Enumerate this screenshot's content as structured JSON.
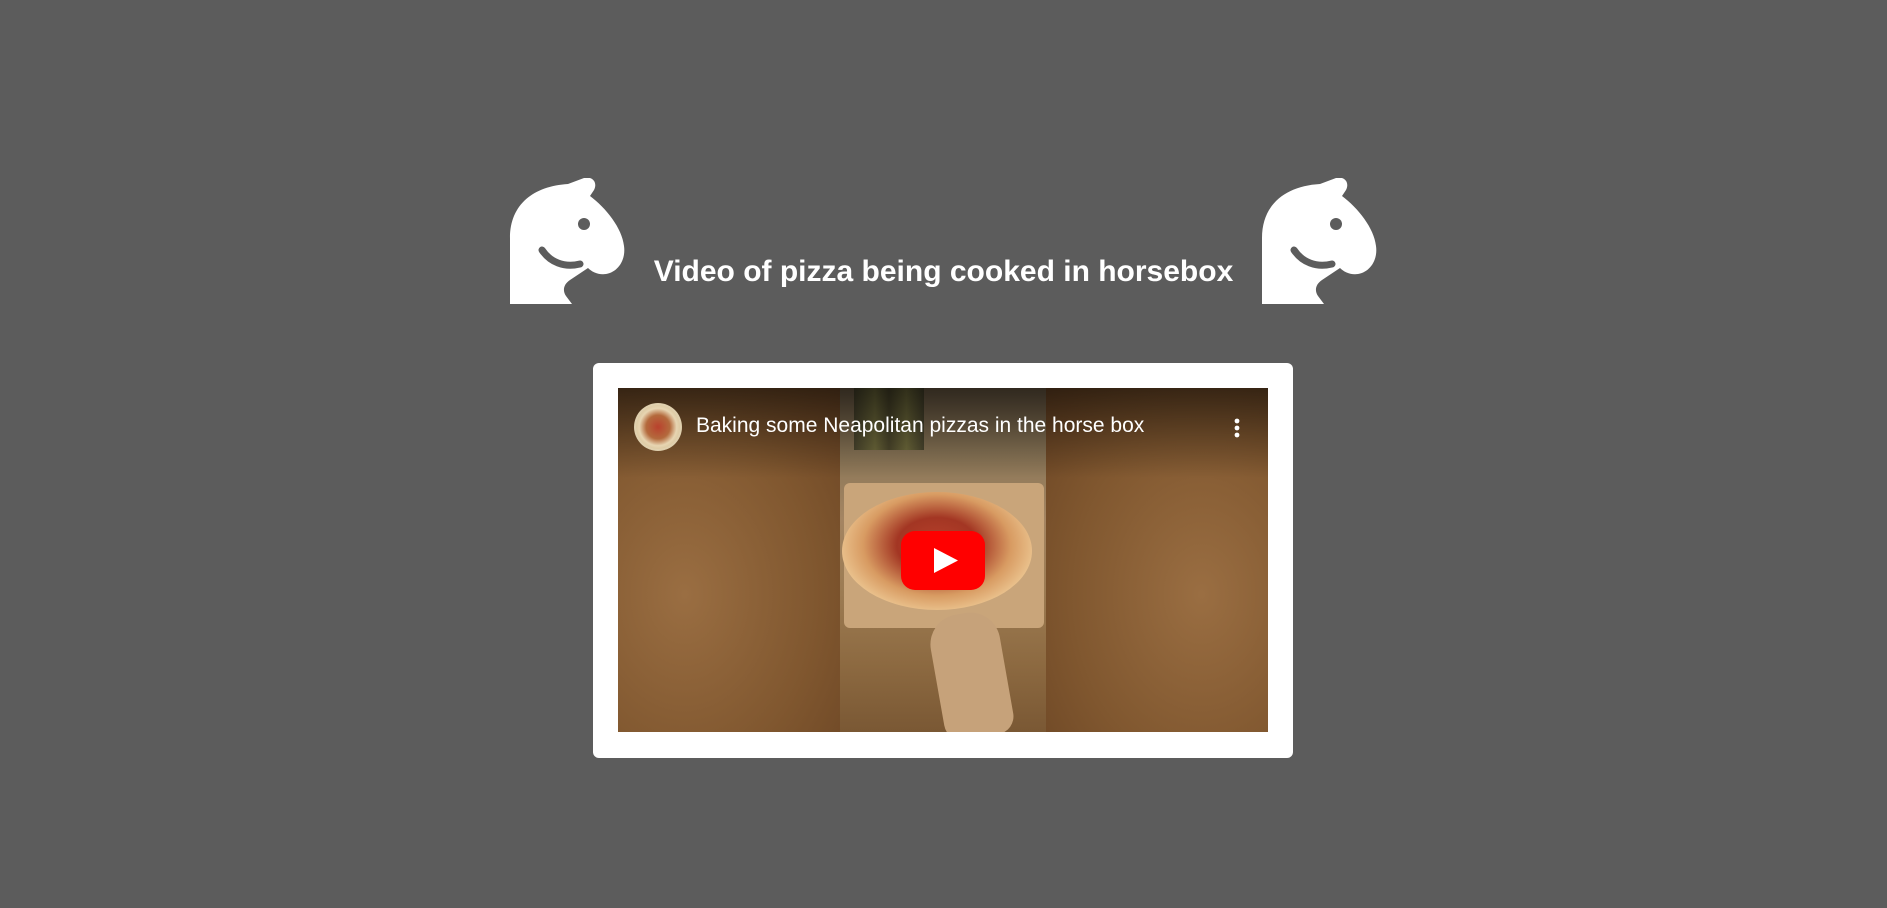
{
  "page": {
    "title": "Video of pizza being cooked in horsebox"
  },
  "header": {
    "left_icon": "horse-head-icon",
    "right_icon": "horse-head-icon"
  },
  "video": {
    "title": "Baking some Neapolitan pizzas in the horse box",
    "channel_avatar": "channel-avatar",
    "more_icon": "more-vertical-icon",
    "play_icon": "youtube-play-icon"
  },
  "colors": {
    "background": "#5c5c5c",
    "card": "#ffffff",
    "title_text": "#ffffff",
    "play_red": "#ff0000"
  }
}
